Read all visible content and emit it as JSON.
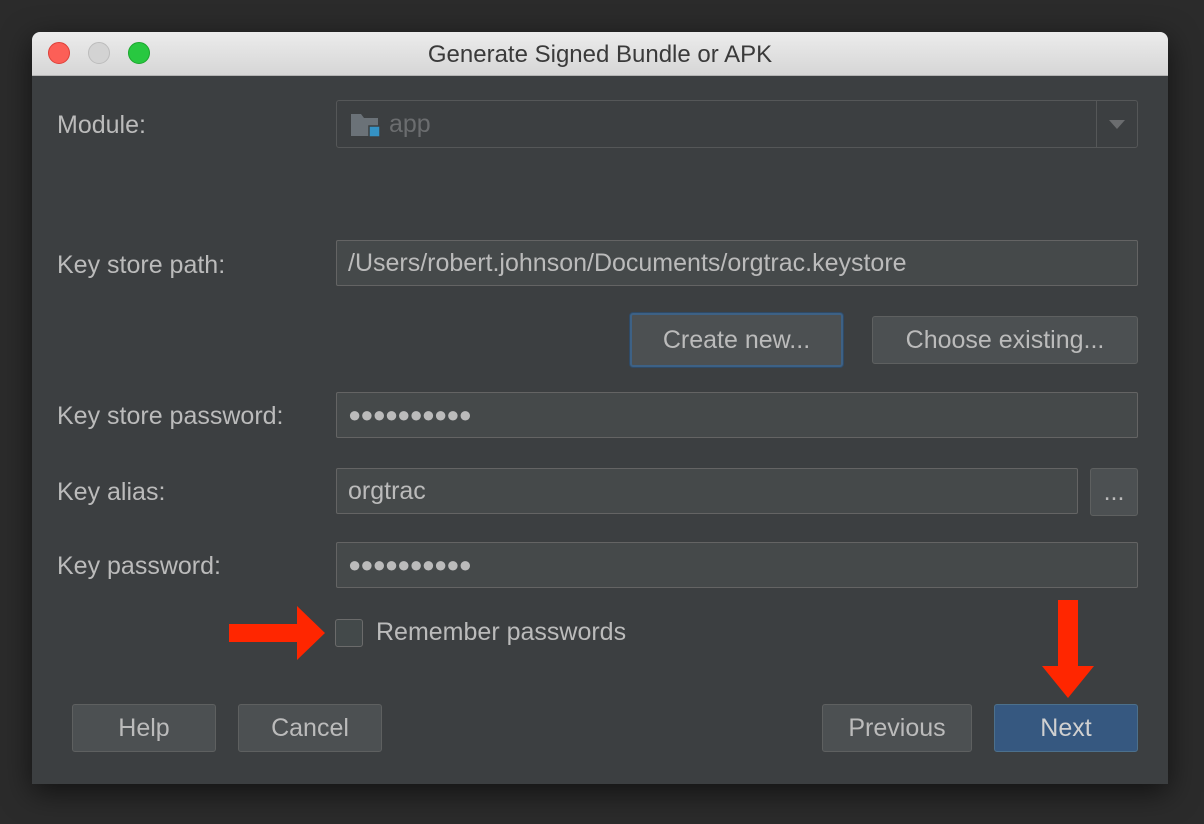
{
  "window": {
    "title": "Generate Signed Bundle or APK"
  },
  "module": {
    "label": "Module:",
    "value": "app",
    "icon": "module-folder-icon"
  },
  "keystore": {
    "path_label": "Key store path:",
    "path_value": "/Users/robert.johnson/Documents/orgtrac.keystore",
    "create_new_label": "Create new...",
    "choose_existing_label": "Choose existing...",
    "password_label": "Key store password:",
    "password_value": "●●●●●●●●●●"
  },
  "key": {
    "alias_label": "Key alias:",
    "alias_value": "orgtrac",
    "browse_label": "...",
    "password_label": "Key password:",
    "password_value": "●●●●●●●●●●"
  },
  "remember": {
    "label": "Remember passwords",
    "checked": false
  },
  "footer": {
    "help_label": "Help",
    "cancel_label": "Cancel",
    "previous_label": "Previous",
    "next_label": "Next"
  },
  "colors": {
    "background": "#3c3f41",
    "primary_button": "#365880",
    "annotation_arrow": "#ff2600"
  }
}
